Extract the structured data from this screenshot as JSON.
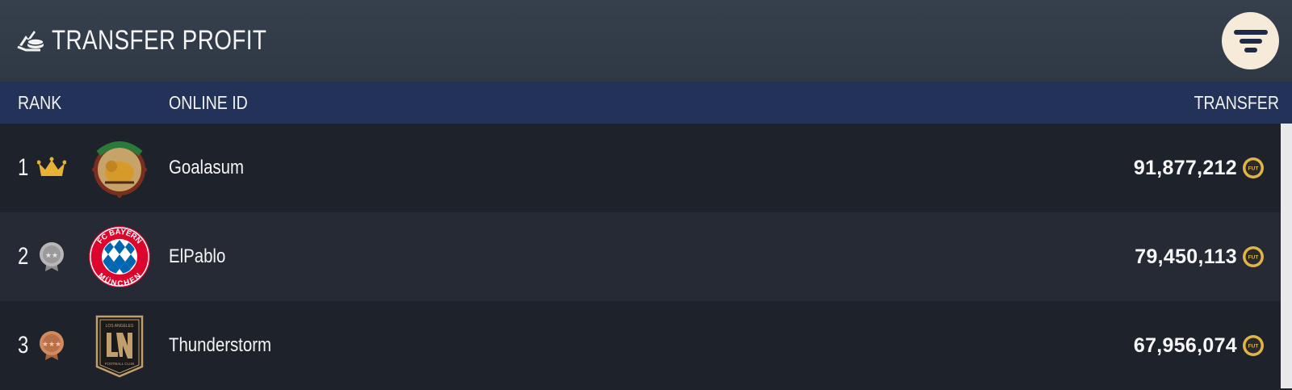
{
  "header": {
    "title": "TRANSFER PROFIT",
    "logo_icon": "transfer-hand-icon",
    "filter_icon": "filter-icon"
  },
  "columns": {
    "rank": "RANK",
    "online_id": "ONLINE ID",
    "transfer": "TRANSFER"
  },
  "rows": [
    {
      "rank": "1",
      "medal": "crown-icon",
      "club_badge": "club-crest-lion",
      "name": "Goalasum",
      "amount": "91,877,212",
      "coin": "FUT"
    },
    {
      "rank": "2",
      "medal": "silver-medal-icon",
      "club_badge": "fc-bayern-munchen-crest",
      "name": "ElPablo",
      "amount": "79,450,113",
      "coin": "FUT"
    },
    {
      "rank": "3",
      "medal": "bronze-medal-icon",
      "club_badge": "los-angeles-fc-crest",
      "name": "Thunderstorm",
      "amount": "67,956,074",
      "coin": "FUT"
    }
  ],
  "colors": {
    "header_bg": "#36404c",
    "column_header_bg": "#233258",
    "filter_button_bg": "#f6ead8",
    "gold": "#e7b235",
    "silver": "#a9a9a9",
    "bronze": "#c77e52"
  },
  "badge_text": {
    "bayern_top": "FC BAYERN",
    "bayern_bottom": "MÜNCHEN",
    "lafc_top": "LOS ANGELES",
    "lafc_bottom": "FOOTBALL CLUB"
  }
}
